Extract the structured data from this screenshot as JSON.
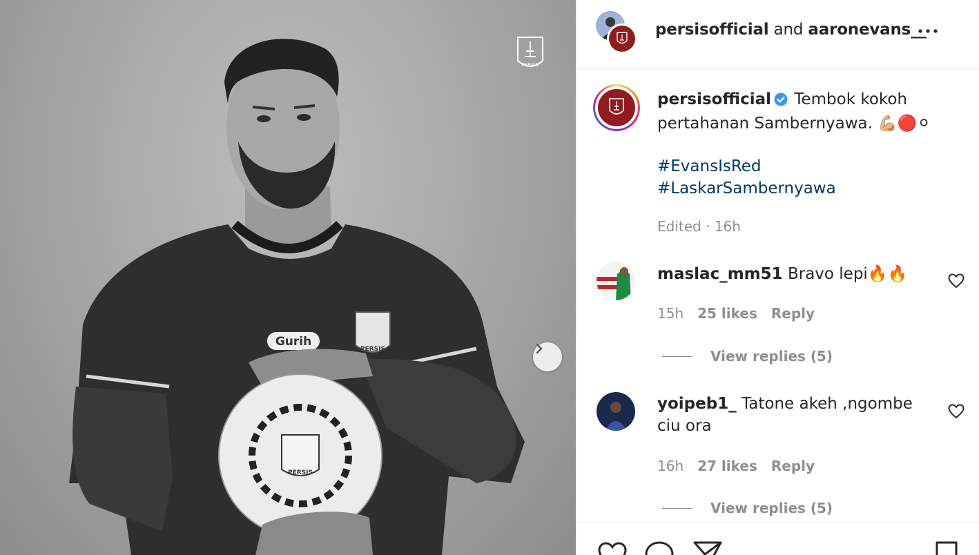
{
  "header": {
    "user1": "persisofficial",
    "joiner": "and",
    "user2": "aaronevans__",
    "more_icon": "more-horizontal-icon"
  },
  "photo": {
    "crest_text": "PERSIS",
    "next_icon": "chevron-right-icon",
    "brand_mark": "Gurih"
  },
  "caption": {
    "username": "persisofficial",
    "verified_icon": "verified-badge-icon",
    "text": "Tembok kokoh pertahanan Sambernyawa. 💪🏼🔴⚪",
    "hashtags": [
      "#EvansIsRed",
      "#LaskarSambernyawa"
    ],
    "edited": "Edited",
    "separator": "·",
    "time": "16h"
  },
  "comments": [
    {
      "username": "maslac_mm51",
      "text": "Bravo lepi🔥🔥",
      "time": "15h",
      "likes": "25 likes",
      "reply": "Reply",
      "view_replies": "View replies (5)"
    },
    {
      "username": "yoipeb1_",
      "text": "Tatone akeh ,ngombe ciu ora",
      "time": "16h",
      "likes": "27 likes",
      "reply": "Reply",
      "view_replies": "View replies (5)"
    }
  ],
  "actions": {
    "icons": [
      "heart-icon",
      "comment-icon",
      "share-icon",
      "bookmark-icon"
    ]
  },
  "colors": {
    "link": "#00376b",
    "muted": "#8e8e8e",
    "verified": "#3897f0",
    "brand": "#8f1c1f"
  }
}
